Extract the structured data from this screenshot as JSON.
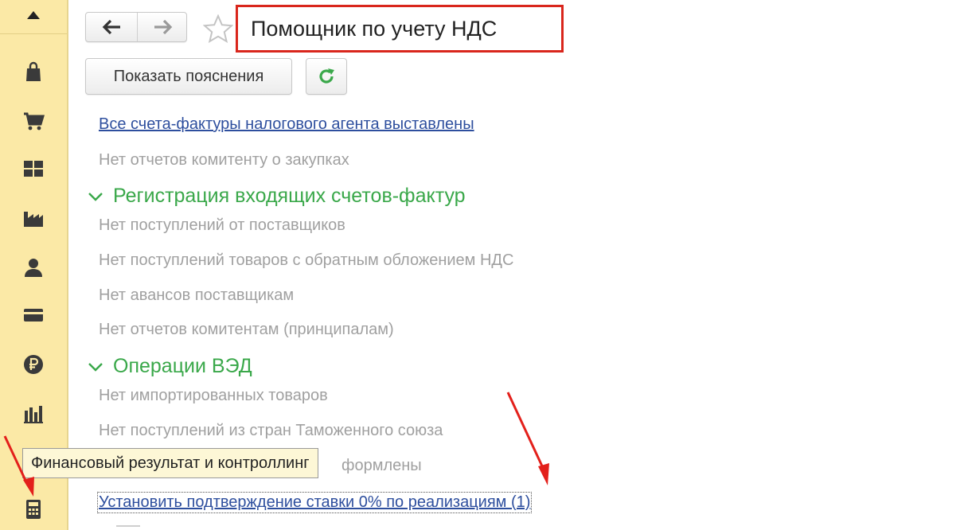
{
  "window": {
    "title": "Помощник по учету НДС"
  },
  "toolbar": {
    "back_icon": "arrow-left-icon",
    "forward_icon": "arrow-right-icon",
    "favorite_icon": "star-icon",
    "explain_label": "Показать пояснения",
    "refresh_icon": "refresh-icon"
  },
  "content": {
    "items_top": [
      {
        "text": "Все счета-фактуры налогового агента выставлены",
        "kind": "link"
      },
      {
        "text": "Нет отчетов комитенту о закупках",
        "kind": "muted"
      }
    ],
    "section1": {
      "title": "Регистрация входящих счетов-фактур",
      "items": [
        "Нет поступлений от поставщиков",
        "Нет поступлений товаров с обратным обложением НДС",
        "Нет авансов поставщикам",
        "Нет отчетов комитентам (принципалам)"
      ]
    },
    "section2": {
      "title": "Операции ВЭД",
      "items": [
        "Нет импортированных товаров",
        "Нет поступлений из стран Таможенного союза",
        "формлены"
      ],
      "link": "Установить подтверждение ставки 0% по реализациям (1)"
    }
  },
  "sidebar": {
    "icons": [
      "bag-icon",
      "cart-icon",
      "warehouse-icon",
      "factory-icon",
      "person-icon",
      "card-icon",
      "ruble-icon",
      "bar-chart-icon",
      "calculator-icon"
    ],
    "tooltip": "Финансовый результат и контроллинг"
  },
  "colors": {
    "sidebar_bg": "#fbe9a6",
    "accent_green": "#3aa84a",
    "link_blue": "#2e4f9e",
    "highlight_red": "#d9261c"
  }
}
